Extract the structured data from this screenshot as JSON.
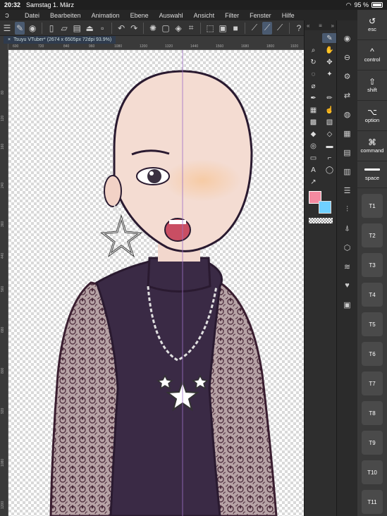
{
  "status_bar": {
    "time": "20:32",
    "date": "Samstag 1. März",
    "battery": "95 %"
  },
  "menu": [
    "Datei",
    "Bearbeiten",
    "Animation",
    "Ebene",
    "Auswahl",
    "Ansicht",
    "Filter",
    "Fenster",
    "Hilfe"
  ],
  "document": {
    "tab_title": "Tsuyu VTuber* (2674 x 6505px 72dpi 93.9%)"
  },
  "ruler_top": [
    "600",
    "720",
    "840",
    "960",
    "1080",
    "1200",
    "1320",
    "1440",
    "1560",
    "1680",
    "1800",
    "1920"
  ],
  "ruler_left": [
    "80",
    "120",
    "160",
    "240",
    "360",
    "440",
    "560",
    "680",
    "800",
    "920",
    "1080",
    "1200"
  ],
  "colors": {
    "main": "#f48aa0",
    "sub": "#6fd0ff",
    "accent": "#4a5a70"
  },
  "edge_keys": {
    "esc": "esc",
    "control": "control",
    "shift": "shift",
    "option": "option",
    "command": "command",
    "space": "space",
    "t_keys": [
      "T1",
      "T2",
      "T3",
      "T4",
      "T5",
      "T6",
      "T7",
      "T8",
      "T9",
      "T10",
      "T11"
    ]
  }
}
